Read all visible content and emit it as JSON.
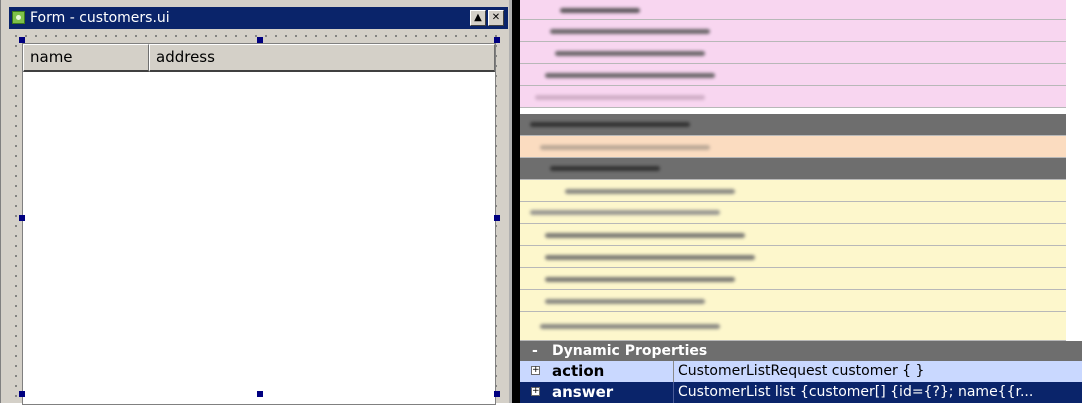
{
  "form_window": {
    "title": "Form - customers.ui",
    "icon": "designer-app-icon",
    "buttons": {
      "maximize": "▲",
      "close": "✕"
    },
    "table": {
      "columns": [
        {
          "label": "name"
        },
        {
          "label": "address"
        }
      ]
    }
  },
  "property_editor": {
    "colors": {
      "pink": "#f8d6f0",
      "dark_gray": "#6e6e6e",
      "peach": "#fbdcc0",
      "light_yellow": "#fdf7cc",
      "selected": "#0a246a",
      "highlight": "#c9d8ff"
    },
    "dynamic_section": {
      "toggle": "-",
      "title": "Dynamic Properties",
      "rows": [
        {
          "name": "action",
          "value": "CustomerListRequest customer { }",
          "selected": false
        },
        {
          "name": "answer",
          "value": "CustomerList list {customer[] {id={?}; name{{r...",
          "selected": true
        }
      ]
    }
  }
}
